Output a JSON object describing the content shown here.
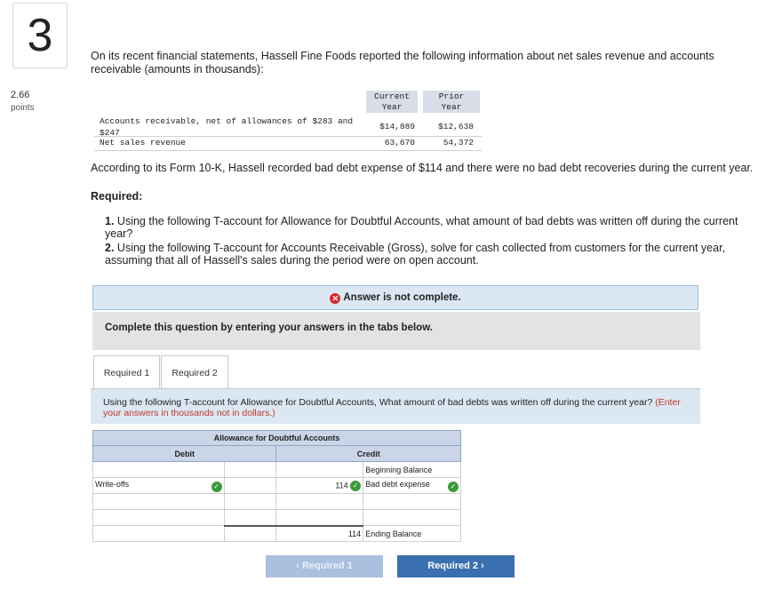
{
  "question": {
    "number": "3",
    "points_value": "2.66",
    "points_label": "points"
  },
  "intro_text": "On its recent financial statements, Hassell Fine Foods reported the following information about net sales revenue and accounts receivable (amounts in thousands):",
  "financials": {
    "col_current": "Current\nYear",
    "col_prior": "Prior\nYear",
    "rows": [
      {
        "label": "Accounts receivable, net of allowances of $283 and $247",
        "current": "$14,889",
        "prior": "$12,638"
      },
      {
        "label": "Net sales revenue",
        "current": "63,670",
        "prior": "54,372"
      }
    ]
  },
  "form_text": "According to its Form 10-K, Hassell recorded bad debt expense of $114 and there were no bad debt recoveries during the current year.",
  "required_heading": "Required:",
  "requirements": [
    {
      "num": "1.",
      "text": "Using the following T-account for Allowance for Doubtful Accounts, what amount of bad debts was written off during the current year?"
    },
    {
      "num": "2.",
      "text": "Using the following T-account for Accounts Receivable (Gross), solve for cash collected from customers for the current year, assuming that all of Hassell's sales during the period were on open account."
    }
  ],
  "status": {
    "text": "Answer is not complete."
  },
  "complete_text": "Complete this question by entering your answers in the tabs below.",
  "tabs": [
    {
      "label": "Required 1"
    },
    {
      "label": "Required 2"
    }
  ],
  "panel": {
    "text": "Using the following T-account for Allowance for Doubtful Accounts, What amount of bad debts was written off during the current year?",
    "hint": "(Enter your answers in thousands not in dollars.)"
  },
  "t_account": {
    "title": "Allowance for Doubtful Accounts",
    "debit_label": "Debit",
    "credit_label": "Credit",
    "beginning_balance": "Beginning Balance",
    "write_offs": "Write-offs",
    "bad_debt_value": "114",
    "bad_debt_label": "Bad debt expense",
    "ending_value": "114",
    "ending_label": "Ending Balance"
  },
  "nav": {
    "prev": "Required 1",
    "next": "Required 2"
  },
  "colors": {
    "accent": "#3a6fb0",
    "error": "#d9262b",
    "correct": "#3a9a3a",
    "panel": "#dbe8f3"
  }
}
